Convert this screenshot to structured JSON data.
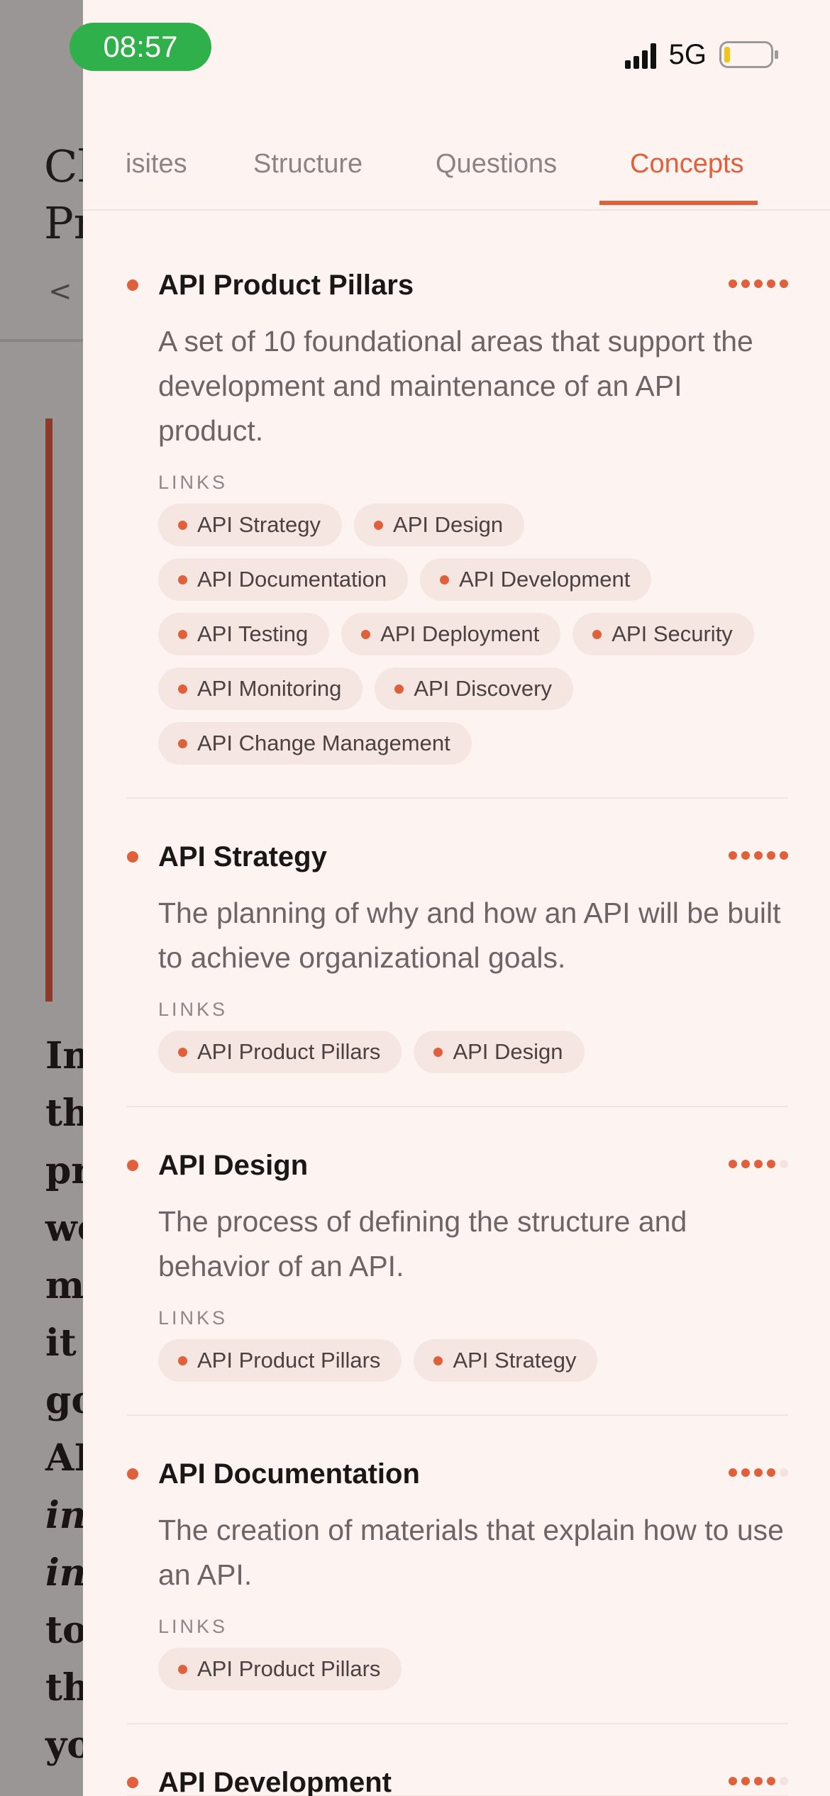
{
  "status_bar": {
    "time": "08:57",
    "network": "5G",
    "battery_level": 0.12
  },
  "background_page": {
    "title_lines": [
      "Cl",
      "Pr"
    ],
    "back_glyph": "< (",
    "paragraph_lines": [
      {
        "text": "In",
        "italic": false
      },
      {
        "text": "th",
        "italic": false
      },
      {
        "text": "pr",
        "italic": false
      },
      {
        "text": "wo",
        "italic": false
      },
      {
        "text": "m",
        "italic": false
      },
      {
        "text": "it",
        "italic": false
      },
      {
        "text": "go",
        "italic": false
      },
      {
        "text": "AI",
        "italic": false
      },
      {
        "text": "in",
        "italic": true
      },
      {
        "text": "in",
        "italic": true
      },
      {
        "text": "to",
        "italic": false
      },
      {
        "text": "th",
        "italic": false
      },
      {
        "text": "yo",
        "italic": false
      }
    ]
  },
  "tabs": [
    {
      "label": "isites",
      "active": false
    },
    {
      "label": "Structure",
      "active": false
    },
    {
      "label": "Questions",
      "active": false
    },
    {
      "label": "Concepts",
      "active": true
    }
  ],
  "links_label": "LINKS",
  "concepts": [
    {
      "title": "API Product Pillars",
      "rating": 5,
      "description": "A set of 10 foundational areas that support the development and maintenance of an API product.",
      "links": [
        "API Strategy",
        "API Design",
        "API Documentation",
        "API Development",
        "API Testing",
        "API Deployment",
        "API Security",
        "API Monitoring",
        "API Discovery",
        "API Change Management"
      ]
    },
    {
      "title": "API Strategy",
      "rating": 5,
      "description": "The planning of why and how an API will be built to achieve organizational goals.",
      "links": [
        "API Product Pillars",
        "API Design"
      ]
    },
    {
      "title": "API Design",
      "rating": 4,
      "description": "The process of defining the structure and behavior of an API.",
      "links": [
        "API Product Pillars",
        "API Strategy"
      ]
    },
    {
      "title": "API Documentation",
      "rating": 4,
      "description": "The creation of materials that explain how to use an API.",
      "links": [
        "API Product Pillars"
      ]
    },
    {
      "title": "API Development",
      "rating": 4,
      "description": "",
      "links": []
    }
  ],
  "colors": {
    "accent": "#e0603c",
    "drawer_bg": "#fdf4f2",
    "chip_bg": "#f6e6e1",
    "status_pill": "#2fb04a"
  }
}
